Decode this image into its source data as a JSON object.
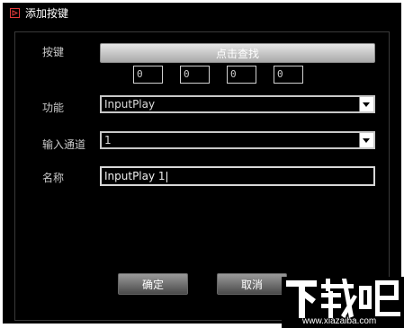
{
  "dialog": {
    "title": "添加按键"
  },
  "fields": {
    "key_label": "按键",
    "find_button_label": "点击查找",
    "codes": [
      "0",
      "0",
      "0",
      "0"
    ],
    "function_label": "功能",
    "function_value": "InputPlay",
    "channel_label": "输入通道",
    "channel_value": "1",
    "name_label": "名称",
    "name_value": "InputPlay 1"
  },
  "buttons": {
    "ok": "确定",
    "cancel": "取消"
  },
  "watermark": {
    "logo_text": "下载吧",
    "url": "www.xiazaiba.com"
  },
  "colors": {
    "background": "#000000",
    "title_icon": "#e23a3a",
    "text": "#c8c8c8"
  }
}
